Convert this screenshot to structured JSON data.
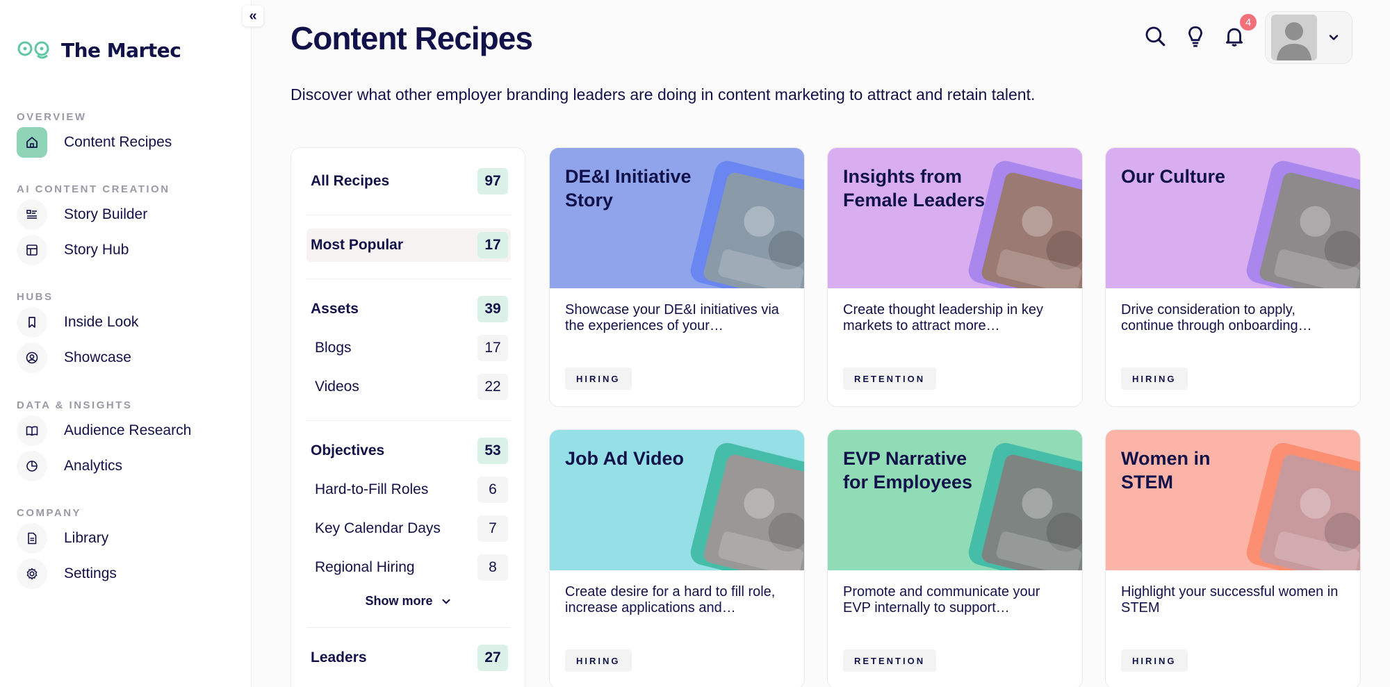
{
  "app": {
    "brand": "The Martec"
  },
  "sidebar": {
    "collapse_glyph": "«",
    "sections": [
      {
        "label": "OVERVIEW",
        "items": [
          {
            "label": "Content Recipes",
            "icon": "home-icon",
            "active": true
          }
        ]
      },
      {
        "label": "AI CONTENT CREATION",
        "items": [
          {
            "label": "Story Builder",
            "icon": "list-icon"
          },
          {
            "label": "Story Hub",
            "icon": "layout-icon"
          }
        ]
      },
      {
        "label": "HUBS",
        "items": [
          {
            "label": "Inside Look",
            "icon": "bookmark-icon"
          },
          {
            "label": "Showcase",
            "icon": "user-circle-icon"
          }
        ]
      },
      {
        "label": "DATA & INSIGHTS",
        "items": [
          {
            "label": "Audience Research",
            "icon": "book-open-icon"
          },
          {
            "label": "Analytics",
            "icon": "pie-chart-icon"
          }
        ]
      },
      {
        "label": "COMPANY",
        "items": [
          {
            "label": "Library",
            "icon": "document-icon"
          },
          {
            "label": "Settings",
            "icon": "gear-icon"
          }
        ]
      }
    ]
  },
  "header": {
    "title": "Content Recipes",
    "subtitle": "Discover what other employer branding leaders are doing in content marketing to attract and retain talent.",
    "notification_count": "4"
  },
  "filters": {
    "all": {
      "label": "All Recipes",
      "count": "97"
    },
    "popular": {
      "label": "Most Popular",
      "count": "17"
    },
    "assets": {
      "label": "Assets",
      "count": "39",
      "items": [
        {
          "label": "Blogs",
          "count": "17"
        },
        {
          "label": "Videos",
          "count": "22"
        }
      ]
    },
    "objectives": {
      "label": "Objectives",
      "count": "53",
      "items": [
        {
          "label": "Hard-to-Fill Roles",
          "count": "6"
        },
        {
          "label": "Key Calendar Days",
          "count": "7"
        },
        {
          "label": "Regional Hiring",
          "count": "8"
        }
      ]
    },
    "show_more": "Show more",
    "leaders": {
      "label": "Leaders",
      "count": "27"
    }
  },
  "cards": [
    {
      "title": "DE&I Initiative Story",
      "description": "Showcase your DE&I initiatives via the experiences of your…",
      "tag": "HIRING",
      "bg": "#90a4ec",
      "frame": "#6a86f0",
      "photo": "#8a9aa8"
    },
    {
      "title": "Insights from Female Leaders",
      "description": "Create thought leadership in key markets to attract more…",
      "tag": "RETENTION",
      "bg": "#d8aef0",
      "frame": "#a987ec",
      "photo": "#9a7a72"
    },
    {
      "title": "Our Culture",
      "description": "Drive consideration to apply, continue through onboarding…",
      "tag": "HIRING",
      "bg": "#d8aef0",
      "frame": "#a987ec",
      "photo": "#8e8a8c"
    },
    {
      "title": "Job Ad Video",
      "description": "Create desire for a hard to fill role, increase applications and…",
      "tag": "HIRING",
      "bg": "#94e0e6",
      "frame": "#45bda8",
      "photo": "#9a9896"
    },
    {
      "title": "EVP Narrative for Employees",
      "description": "Promote and communicate your EVP internally to support…",
      "tag": "RETENTION",
      "bg": "#90dcb6",
      "frame": "#45bda8",
      "photo": "#7e8482"
    },
    {
      "title": "Women in STEM",
      "description": "Highlight your successful women in STEM",
      "tag": "HIRING",
      "bg": "#fcb4a8",
      "frame": "#fc8f72",
      "photo": "#c89a9e"
    }
  ]
}
